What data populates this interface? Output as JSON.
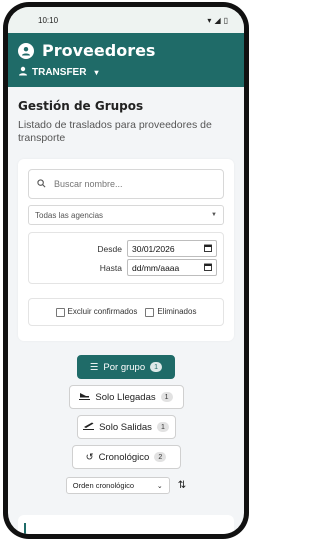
{
  "status": {
    "time": "10:10"
  },
  "appbar": {
    "title": "Proveedores",
    "user": "TRANSFER"
  },
  "page": {
    "title": "Gestión de Grupos",
    "subtitle": "Listado de traslados para proveedores de transporte"
  },
  "filters": {
    "search_placeholder": "Buscar nombre...",
    "agency_select": "Todas las agencias",
    "desde_label": "Desde",
    "desde_value": "30/01/2026",
    "hasta_label": "Hasta",
    "hasta_value": "dd/mm/aaaa",
    "excluir_label": "Excluir confirmados",
    "eliminados_label": "Eliminados"
  },
  "views": [
    {
      "label": "Por grupo",
      "count": "1",
      "active": true
    },
    {
      "label": "Solo Llegadas",
      "count": "1",
      "active": false
    },
    {
      "label": "Solo Salidas",
      "count": "1",
      "active": false
    },
    {
      "label": "Cronológico",
      "count": "2",
      "active": false
    }
  ],
  "sort": {
    "selected": "Orden cronológico"
  },
  "colors": {
    "brand": "#1f6b68"
  }
}
